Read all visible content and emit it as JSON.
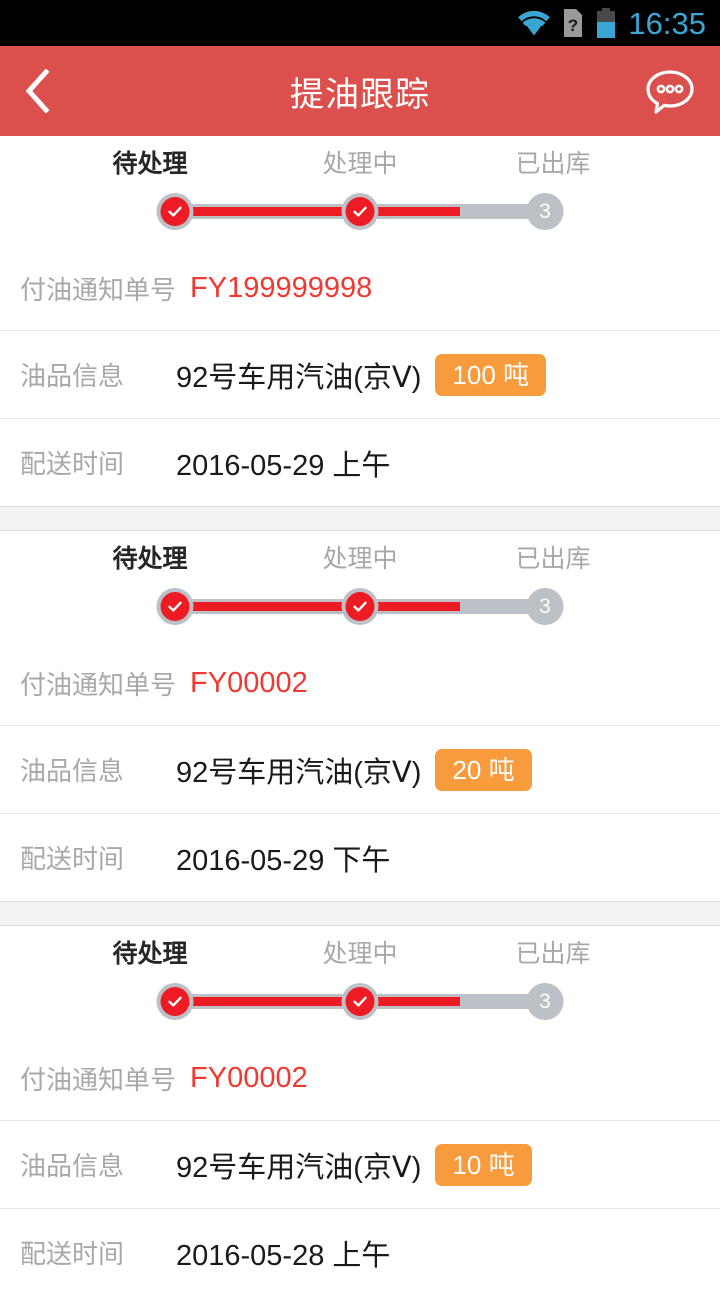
{
  "statusbar": {
    "time": "16:35",
    "icons": [
      "wifi-icon",
      "sim-card-missing-icon",
      "battery-icon"
    ],
    "accent_color": "#3BA6D4"
  },
  "header": {
    "title": "提油跟踪",
    "back_icon": "chevron-left-icon",
    "action_icon": "chat-bubble-more-icon",
    "background_color": "#DB504C"
  },
  "stepper": {
    "labels": [
      "待处理",
      "处理中",
      "已出库"
    ],
    "pending_number": "3",
    "active_color": "#ED1C24",
    "inactive_color": "#bcc0c7"
  },
  "fields": {
    "order_label": "付油通知单号",
    "product_label": "油品信息",
    "delivery_label": "配送时间"
  },
  "colors": {
    "order_number": "#ED3B34",
    "badge": "#F89B3C"
  },
  "cards": [
    {
      "order_no": "FY199999998",
      "product": "92号车用汽油(京Ⅴ)",
      "quantity": "100 吨",
      "delivery_time": "2016-05-29 上午"
    },
    {
      "order_no": "FY00002",
      "product": "92号车用汽油(京Ⅴ)",
      "quantity": "20 吨",
      "delivery_time": "2016-05-29 下午"
    },
    {
      "order_no": "FY00002",
      "product": "92号车用汽油(京Ⅴ)",
      "quantity": "10 吨",
      "delivery_time": "2016-05-28 上午"
    }
  ]
}
